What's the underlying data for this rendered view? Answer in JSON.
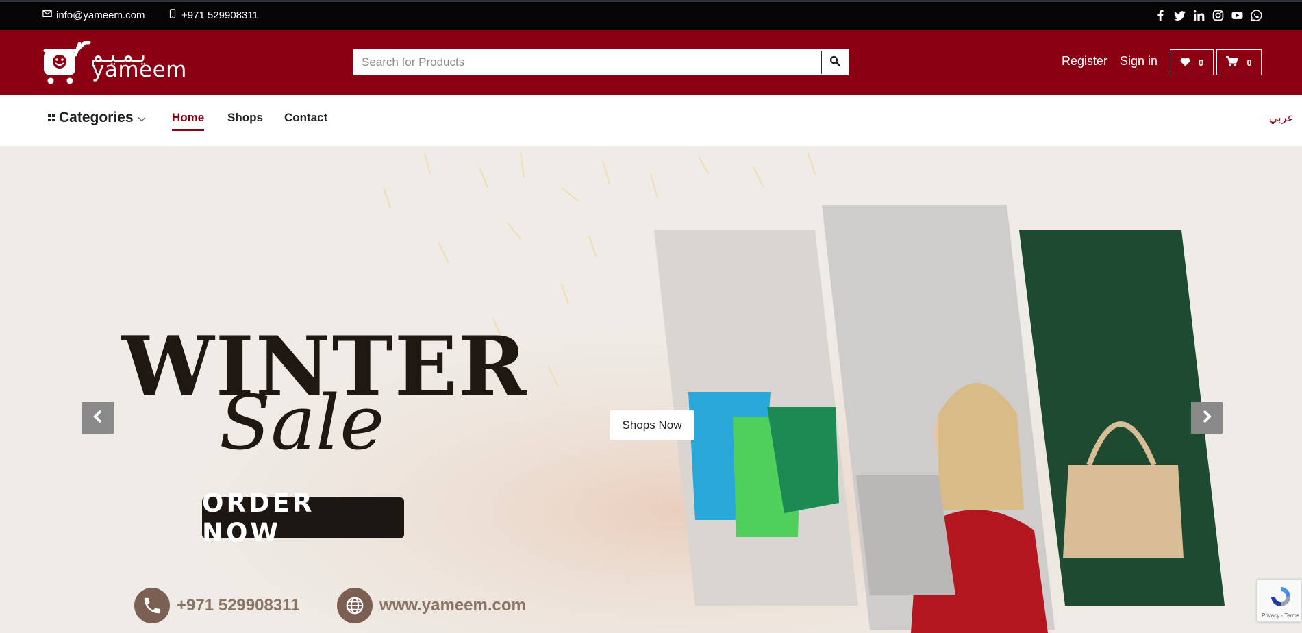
{
  "topbar": {
    "email": "info@yameem.com",
    "phone": "+971 529908311",
    "social": [
      "facebook-icon",
      "twitter-icon",
      "linkedin-icon",
      "instagram-icon",
      "youtube-icon",
      "whatsapp-icon"
    ]
  },
  "header": {
    "logo_text": "yameem",
    "logo_arabic": "يـمـيـم",
    "search_placeholder": "Search for Products",
    "register_label": "Register",
    "signin_label": "Sign in",
    "wishlist_count": "0",
    "cart_count": "0"
  },
  "nav": {
    "categories_label": "Categories",
    "links": [
      {
        "label": "Home",
        "active": true
      },
      {
        "label": "Shops",
        "active": false
      },
      {
        "label": "Contact",
        "active": false
      }
    ],
    "language_label": "عربي"
  },
  "hero": {
    "headline": "WINTER",
    "subheadline": "Sale",
    "order_label": "ORDER NOW",
    "phone": "+971 529908311",
    "website": "www.yameem.com",
    "cta_label": "Shops Now"
  },
  "recaptcha": {
    "text": "Privacy - Terms"
  },
  "colors": {
    "brand": "#8b0012",
    "topbar": "#050505",
    "hero_bg": "#efebe6"
  }
}
